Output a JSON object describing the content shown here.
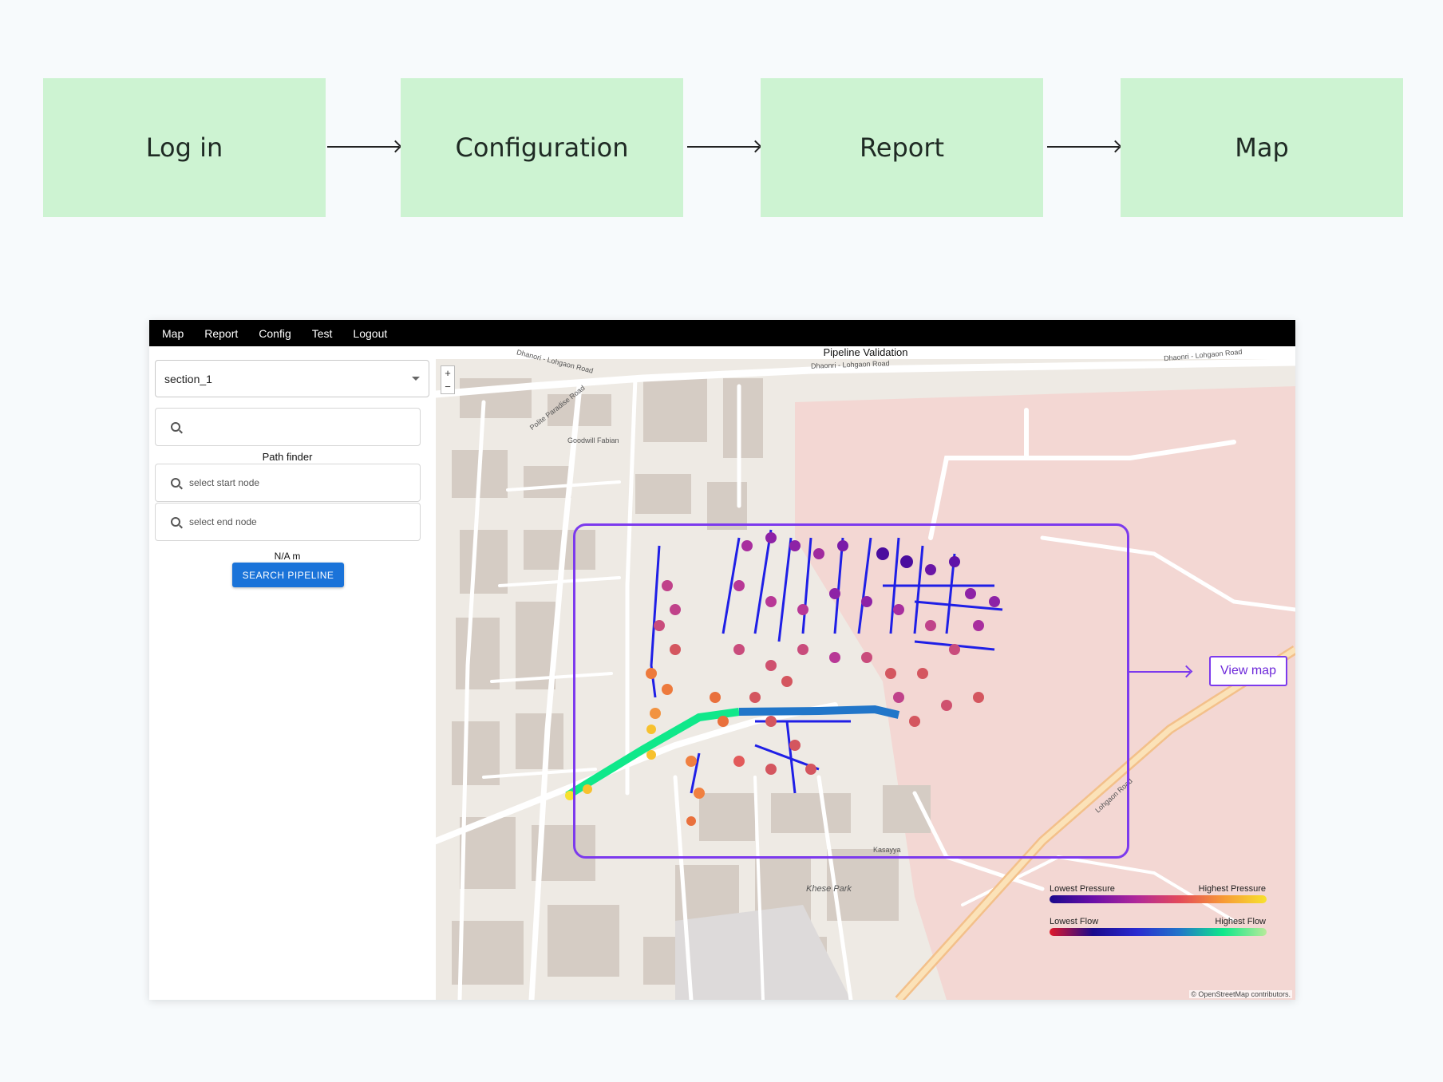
{
  "flow": {
    "steps": [
      "Log in",
      "Configuration",
      "Report",
      "Map"
    ]
  },
  "app": {
    "nav": [
      "Map",
      "Report",
      "Config",
      "Test",
      "Logout"
    ],
    "sidebar": {
      "section_select": "section_1",
      "search_placeholder": "",
      "path_finder_label": "Path finder",
      "start_node_placeholder": "select start node",
      "end_node_placeholder": "select end node",
      "distance": "N/A m",
      "search_button": "SEARCH PIPELINE"
    },
    "map": {
      "title": "Pipeline Validation",
      "zoom_in": "+",
      "zoom_out": "−",
      "road_labels": [
        "Dhanori - Lohgaon Road",
        "Dhaonri - Lohgaon Road",
        "Dhaonri - Lohgaon Road",
        "Polite Paradise Road",
        "Goodwill Fabian",
        "Khese Park",
        "Kasayya",
        "Lohgaon Road"
      ],
      "attribution": "© OpenStreetMap contributors.",
      "legend": {
        "pressure_low": "Lowest Pressure",
        "pressure_high": "Highest Pressure",
        "flow_low": "Lowest Flow",
        "flow_high": "Highest Flow"
      }
    }
  },
  "callout": {
    "view_map_label": "View map"
  },
  "colors": {
    "flow_box": "#cdf3d2",
    "accent": "#7c3aed",
    "button": "#1a73d9",
    "pipe": "#1f1fe6"
  }
}
